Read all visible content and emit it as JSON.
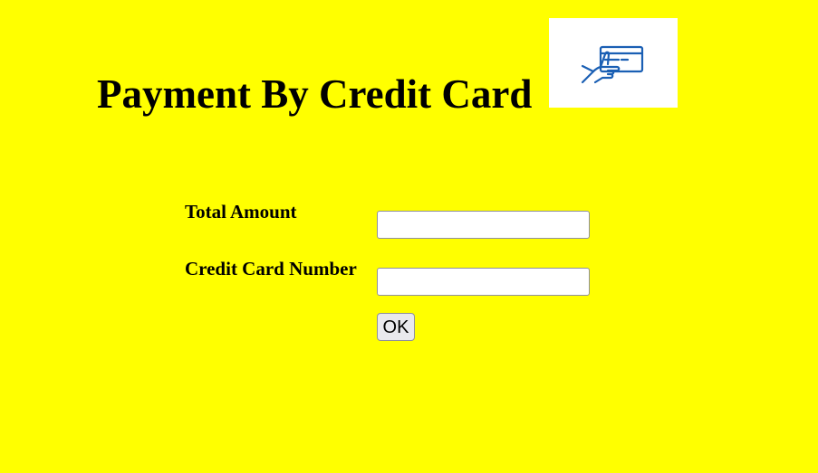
{
  "page": {
    "title": "Payment By Credit Card",
    "card_image_icon": "hand-holding-credit-card-icon",
    "background_color": "#ffff00",
    "icon_color": "#1a5fb4"
  },
  "form": {
    "total_amount": {
      "label": "Total Amount",
      "value": "",
      "placeholder": ""
    },
    "credit_card_number": {
      "label": "Credit Card Number",
      "value": "",
      "placeholder": ""
    },
    "ok_button_label": "OK"
  }
}
